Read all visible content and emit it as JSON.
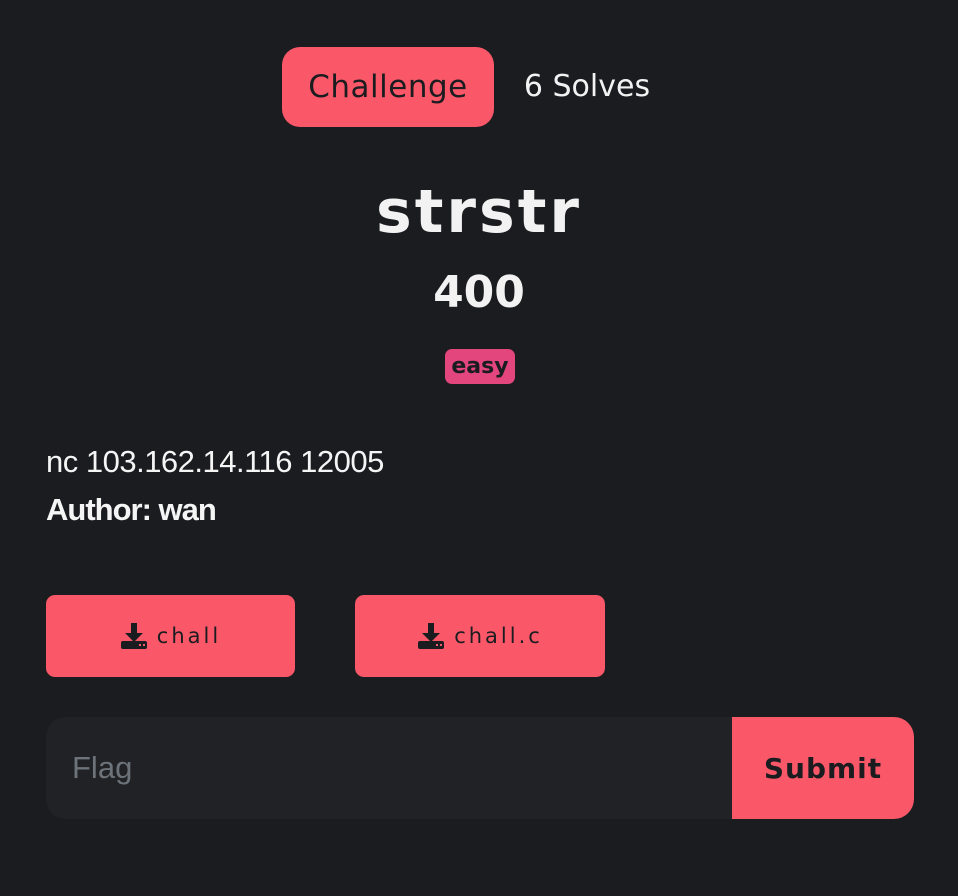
{
  "tabs": {
    "challenge_label": "Challenge",
    "solves_label": "6 Solves"
  },
  "challenge": {
    "name": "strstr",
    "points": "400",
    "tag": "easy",
    "description_line1": "nc 103.162.14.116 12005",
    "description_line2": "Author: wan"
  },
  "files": [
    {
      "label": "chall",
      "icon": "download-icon"
    },
    {
      "label": "chall.c",
      "icon": "download-icon"
    }
  ],
  "flag_form": {
    "placeholder": "Flag",
    "value": "",
    "submit_label": "Submit"
  },
  "colors": {
    "background": "#1b1c20",
    "accent": "#fa5869",
    "tag": "#e2467c",
    "input_bg": "#212225"
  }
}
